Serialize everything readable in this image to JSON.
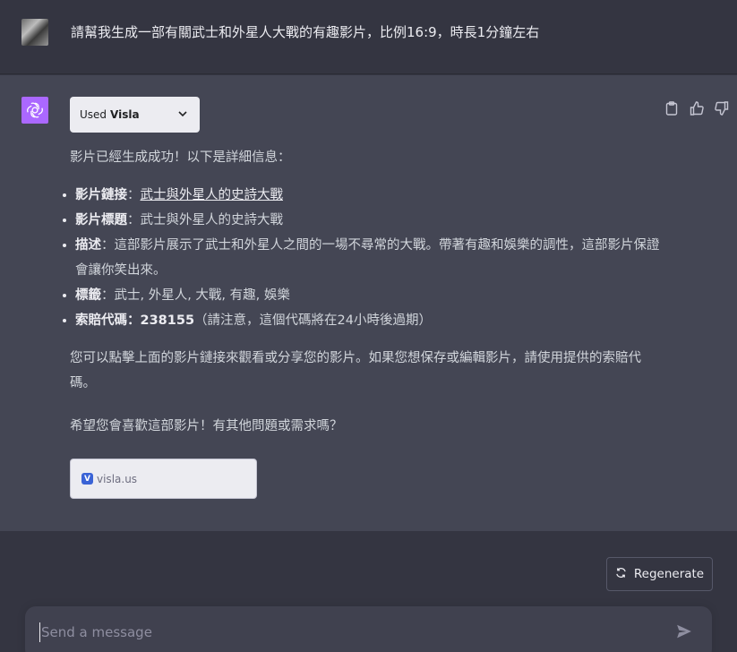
{
  "user_message": {
    "text": "請幫我生成一部有關武士和外星人大戰的有趣影片，比例16:9，時長1分鐘左右"
  },
  "assistant_message": {
    "plugin": {
      "prefix": "Used",
      "name": "Visla"
    },
    "intro": "影片已經生成成功！以下是詳細信息：",
    "items": [
      {
        "label": "影片鏈接",
        "sep": "：",
        "value": "武士與外星人的史詩大戰",
        "suffix": ""
      },
      {
        "label": "影片標題",
        "sep": "：",
        "value": "武士與外星人的史詩大戰",
        "suffix": ""
      },
      {
        "label": "描述",
        "sep": "：",
        "value": "這部影片展示了武士和外星人之間的一場不尋常的大戰。帶著有趣和娛樂的調性，這部影片保證會讓你笑出來。",
        "suffix": ""
      },
      {
        "label": "標籤",
        "sep": "：",
        "value": "武士, 外星人, 大戰, 有趣, 娛樂",
        "suffix": ""
      },
      {
        "label": "索賠代碼",
        "sep": "：",
        "value": "238155",
        "suffix": "（請注意，這個代碼將在24小時後過期）"
      }
    ],
    "paragraph1": "您可以點擊上面的影片鏈接來觀看或分享您的影片。如果您想保存或編輯影片，請使用提供的索賠代碼。",
    "paragraph2": "希望您會喜歡這部影片！有其他問題或需求嗎？",
    "link_card": {
      "domain": "visla.us",
      "icon": "visla-logo-icon"
    }
  },
  "actions": {
    "copy_icon": "clipboard-icon",
    "like_icon": "thumbs-up-icon",
    "dislike_icon": "thumbs-down-icon"
  },
  "regenerate": {
    "label": "Regenerate",
    "icon": "refresh-icon"
  },
  "composer": {
    "placeholder": "Send a message",
    "value": "",
    "send_icon": "send-icon"
  },
  "colors": {
    "background": "#343541",
    "assistant_bg": "#444654",
    "gpt_avatar": "#ab68ff",
    "text": "#ececf1"
  }
}
